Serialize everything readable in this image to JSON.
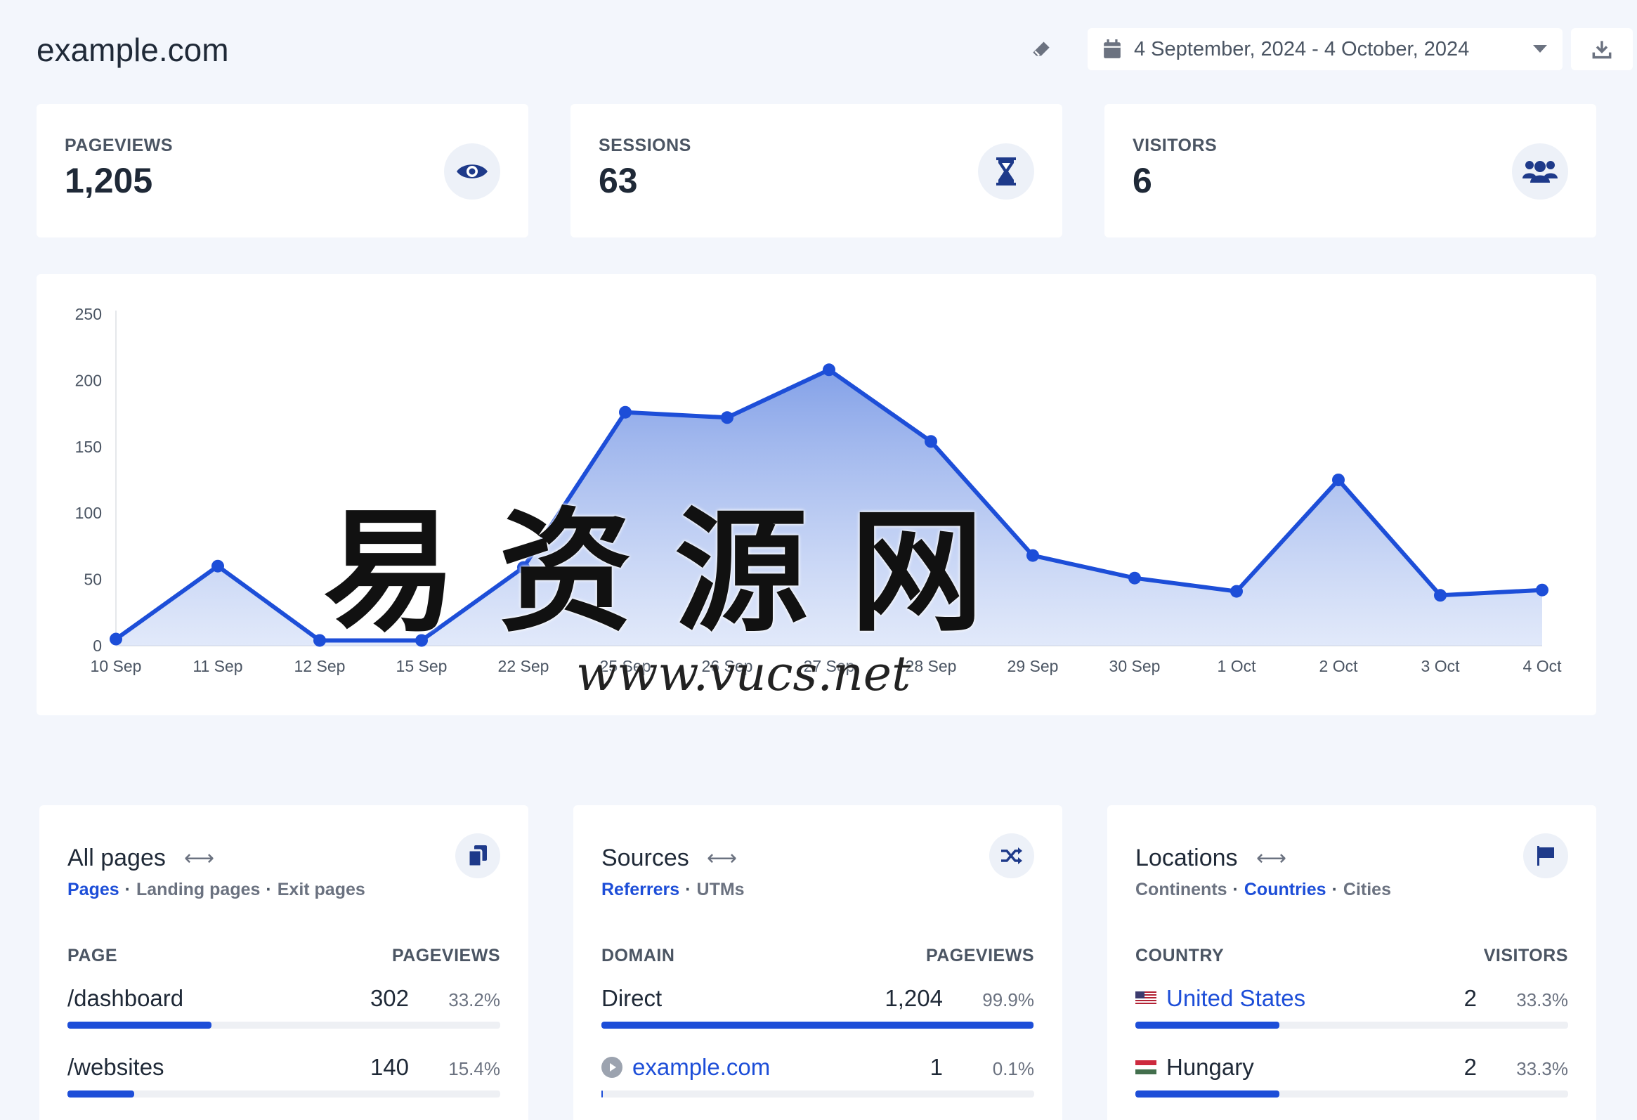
{
  "header": {
    "site": "example.com",
    "date_range": "4 September, 2024 - 4 October, 2024"
  },
  "stats": [
    {
      "label": "PAGEVIEWS",
      "value": "1,205",
      "icon": "eye-icon"
    },
    {
      "label": "SESSIONS",
      "value": "63",
      "icon": "hourglass-icon"
    },
    {
      "label": "VISITORS",
      "value": "6",
      "icon": "users-icon"
    }
  ],
  "chart_data": {
    "type": "area",
    "categories": [
      "10 Sep",
      "11 Sep",
      "12 Sep",
      "15 Sep",
      "22 Sep",
      "25 Sep",
      "26 Sep",
      "27 Sep",
      "28 Sep",
      "29 Sep",
      "30 Sep",
      "1 Oct",
      "2 Oct",
      "3 Oct",
      "4 Oct"
    ],
    "series": [
      {
        "values": [
          5,
          60,
          4,
          4,
          59,
          176,
          172,
          208,
          154,
          68,
          51,
          41,
          125,
          38,
          42
        ]
      }
    ],
    "ylim": [
      0,
      250
    ],
    "yticks": [
      "250",
      "200",
      "150",
      "100",
      "50",
      "0"
    ],
    "grid": false,
    "color": "#1d4ed8"
  },
  "pages_card": {
    "title": "All pages",
    "tabs": [
      "Pages",
      "Landing pages",
      "Exit pages"
    ],
    "active_tab": 0,
    "col_left": "PAGE",
    "col_right": "PAGEVIEWS",
    "rows": [
      {
        "label": "/dashboard",
        "count": "302",
        "pct": "33.2%",
        "fraction": 0.332
      },
      {
        "label": "/websites",
        "count": "140",
        "pct": "15.4%",
        "fraction": 0.154
      }
    ]
  },
  "sources_card": {
    "title": "Sources",
    "tabs": [
      "Referrers",
      "UTMs"
    ],
    "active_tab": 0,
    "col_left": "DOMAIN",
    "col_right": "PAGEVIEWS",
    "rows": [
      {
        "label": "Direct",
        "count": "1,204",
        "pct": "99.9%",
        "fraction": 0.999
      },
      {
        "label": "example.com",
        "count": "1",
        "pct": "0.1%",
        "fraction": 0.001
      }
    ]
  },
  "locations_card": {
    "title": "Locations",
    "tabs": [
      "Continents",
      "Countries",
      "Cities"
    ],
    "active_tab": 1,
    "col_left": "COUNTRY",
    "col_right": "VISITORS",
    "rows": [
      {
        "label": "United States",
        "count": "2",
        "pct": "33.3%",
        "fraction": 0.333
      },
      {
        "label": "Hungary",
        "count": "2",
        "pct": "33.3%",
        "fraction": 0.333
      }
    ]
  },
  "watermark": {
    "main": "易资源网",
    "sub": "www.vucs.net"
  }
}
